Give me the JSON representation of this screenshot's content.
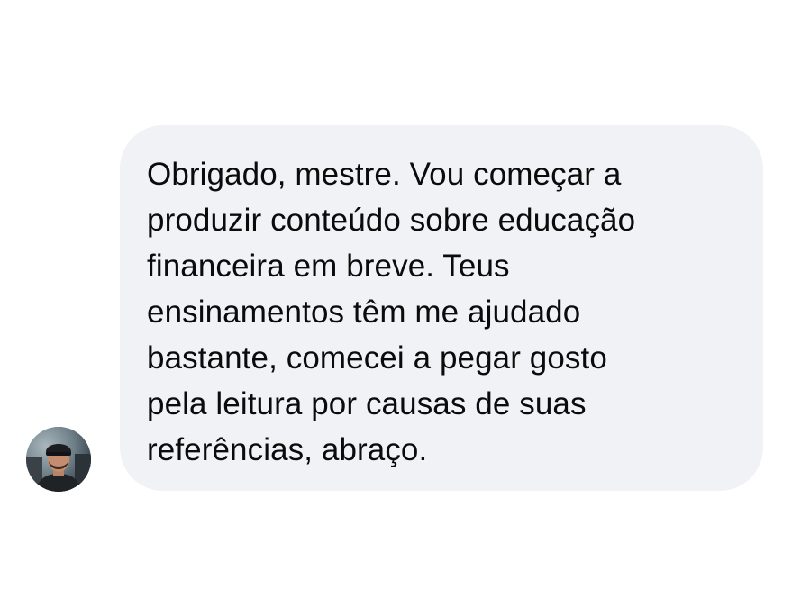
{
  "conversation": {
    "message": {
      "lines": [
        "Obrigado, mestre. Vou começar a",
        "produzir conteúdo sobre educação",
        "financeira em breve. Teus",
        "ensinamentos têm me ajudado",
        "bastante, comecei a pegar gosto",
        "pela leitura por causas de suas",
        "referências, abraço."
      ]
    },
    "avatar": {
      "icon": "user-avatar-photo"
    }
  },
  "colors": {
    "bubble_background": "#f1f2f5",
    "text": "#0b0b0c",
    "page_background": "#ffffff"
  }
}
